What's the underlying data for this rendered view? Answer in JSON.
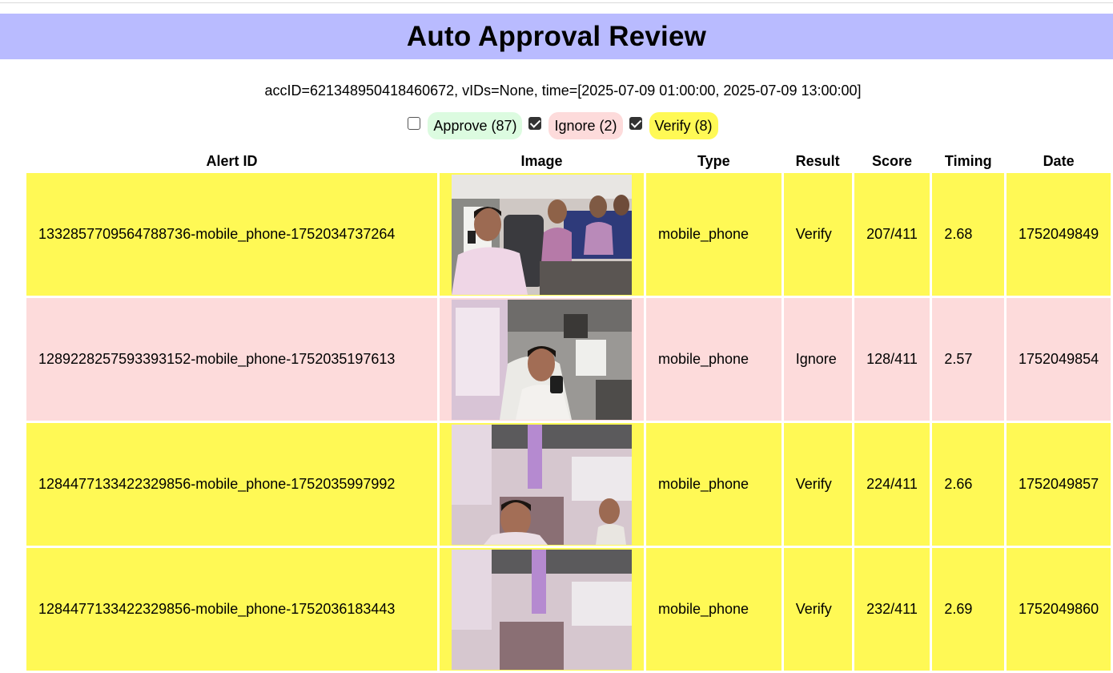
{
  "header": {
    "title": "Auto Approval Review"
  },
  "meta_line": "accID=621348950418460672, vIDs=None, time=[2025-07-09 01:00:00, 2025-07-09 13:00:00]",
  "filters": [
    {
      "label": "Approve (87)",
      "checked": false,
      "color": "#dcfbe0"
    },
    {
      "label": "Ignore (2)",
      "checked": true,
      "color": "#fddbdb"
    },
    {
      "label": "Verify (8)",
      "checked": true,
      "color": "#fff955"
    }
  ],
  "table": {
    "columns": [
      "Alert ID",
      "Image",
      "Type",
      "Result",
      "Score",
      "Timing",
      "Date"
    ],
    "rows": [
      {
        "alert_id": "1332857709564788736-mobile_phone-1752034737264",
        "image": "bus-interior-photo",
        "type": "mobile_phone",
        "result": "Verify",
        "score": "207/411",
        "timing": "2.68",
        "date": "1752049849"
      },
      {
        "alert_id": "1289228257593393152-mobile_phone-1752035197613",
        "image": "driver-cabin-photo",
        "type": "mobile_phone",
        "result": "Ignore",
        "score": "128/411",
        "timing": "2.57",
        "date": "1752049854"
      },
      {
        "alert_id": "1284477133422329856-mobile_phone-1752035997992",
        "image": "bus-interior-photo",
        "type": "mobile_phone",
        "result": "Verify",
        "score": "224/411",
        "timing": "2.66",
        "date": "1752049857"
      },
      {
        "alert_id": "1284477133422329856-mobile_phone-1752036183443",
        "image": "bus-interior-photo",
        "type": "mobile_phone",
        "result": "Verify",
        "score": "232/411",
        "timing": "2.69",
        "date": "1752049860"
      }
    ]
  },
  "colors": {
    "verify_row": "#fff955",
    "ignore_row": "#fddbdb",
    "banner": "#b9bbff"
  }
}
